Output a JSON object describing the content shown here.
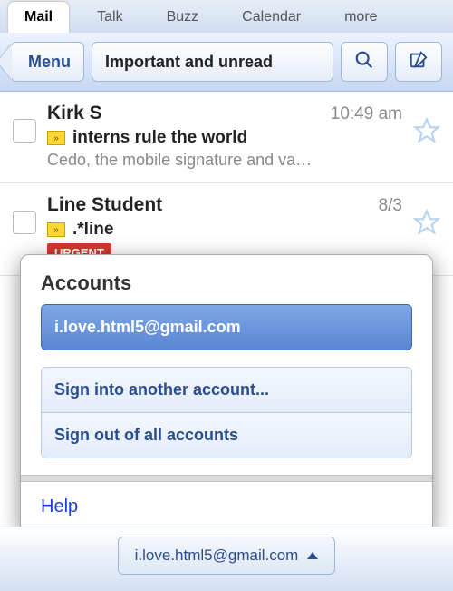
{
  "tabs": {
    "items": [
      "Mail",
      "Talk",
      "Buzz",
      "Calendar",
      "more"
    ],
    "active_index": 0
  },
  "toolbar": {
    "menu_label": "Menu",
    "title": "Important and unread"
  },
  "emails": [
    {
      "sender": "Kirk S",
      "time": "10:49 am",
      "subject": "interns rule the world",
      "preview": "Cedo, the mobile signature and va…",
      "important": true
    },
    {
      "sender": "Line Student",
      "time": "8/3",
      "subject": ".*line",
      "preview": "",
      "important": true,
      "badge": "URGENT"
    }
  ],
  "accounts_popover": {
    "title": "Accounts",
    "current_account": "i.love.html5@gmail.com",
    "options": [
      "Sign into another account...",
      "Sign out of all accounts"
    ],
    "help_label": "Help"
  },
  "footer": {
    "account_email": "i.love.html5@gmail.com"
  }
}
